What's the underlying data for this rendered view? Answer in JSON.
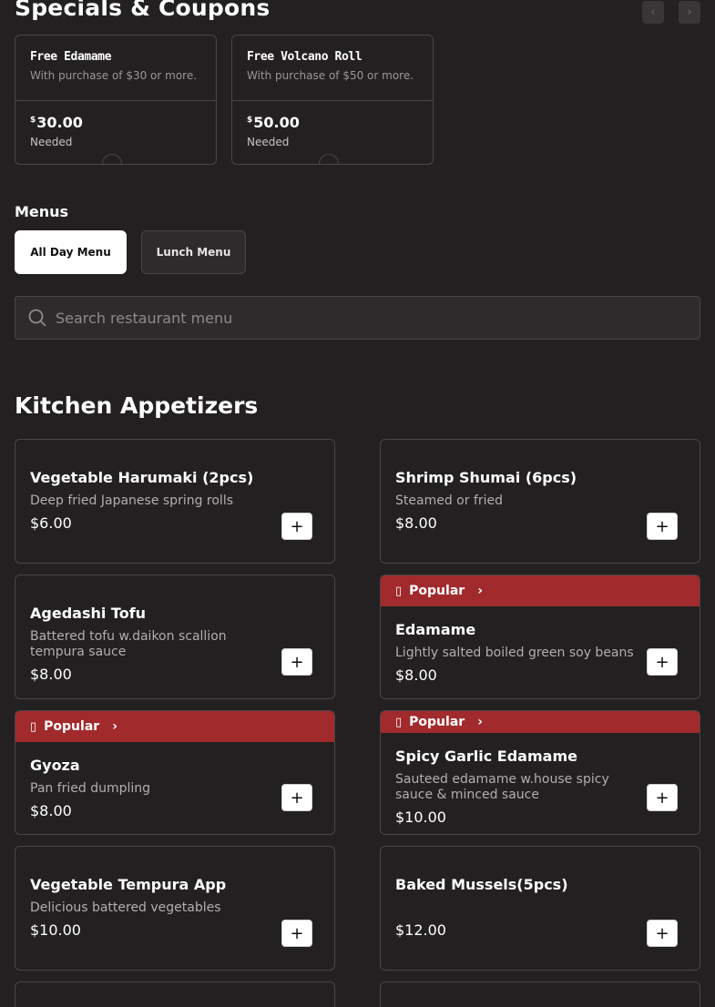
{
  "specials": {
    "title": "Specials & Coupons",
    "prev_icon": "chevron-left-icon",
    "next_icon": "chevron-right-icon",
    "coupons": [
      {
        "title": "Free Edamame",
        "subtitle": "With purchase of $30 or more.",
        "currency": "$",
        "amount": "30.00",
        "needed": "Needed"
      },
      {
        "title": "Free Volcano Roll",
        "subtitle": "With purchase of $50 or more.",
        "currency": "$",
        "amount": "50.00",
        "needed": "Needed"
      }
    ]
  },
  "menus": {
    "label": "Menus",
    "tabs": [
      {
        "label": "All Day Menu",
        "active": true
      },
      {
        "label": "Lunch Menu",
        "active": false
      }
    ]
  },
  "search": {
    "placeholder": "Search restaurant menu",
    "value": ""
  },
  "category": {
    "title": "Kitchen Appetizers",
    "items": [
      {
        "name": "Vegetable Harumaki (2pcs)",
        "description": "Deep fried Japanese spring rolls",
        "price": "$6.00",
        "popular": false
      },
      {
        "name": "Shrimp Shumai (6pcs)",
        "description": "Steamed or fried",
        "price": "$8.00",
        "popular": false
      },
      {
        "name": "Agedashi Tofu",
        "description": "Battered tofu w.daikon scallion tempura sauce",
        "price": "$8.00",
        "popular": false
      },
      {
        "name": "Edamame",
        "description": "Lightly salted boiled green soy beans",
        "price": "$8.00",
        "popular": true
      },
      {
        "name": "Gyoza",
        "description": "Pan fried dumpling",
        "price": "$8.00",
        "popular": true
      },
      {
        "name": "Spicy Garlic Edamame",
        "description": "Sauteed edamame w.house spicy sauce & minced sauce",
        "price": "$10.00",
        "popular": true
      },
      {
        "name": "Vegetable Tempura App",
        "description": "Delicious battered vegetables",
        "price": "$10.00",
        "popular": false
      },
      {
        "name": "Baked Mussels(5pcs)",
        "description": "",
        "price": "$12.00",
        "popular": false
      }
    ],
    "popular_label": "Popular",
    "add_label": "+"
  },
  "colors": {
    "background": "#232021",
    "popular_badge": "#a12a2c",
    "border": "#4a4647"
  }
}
